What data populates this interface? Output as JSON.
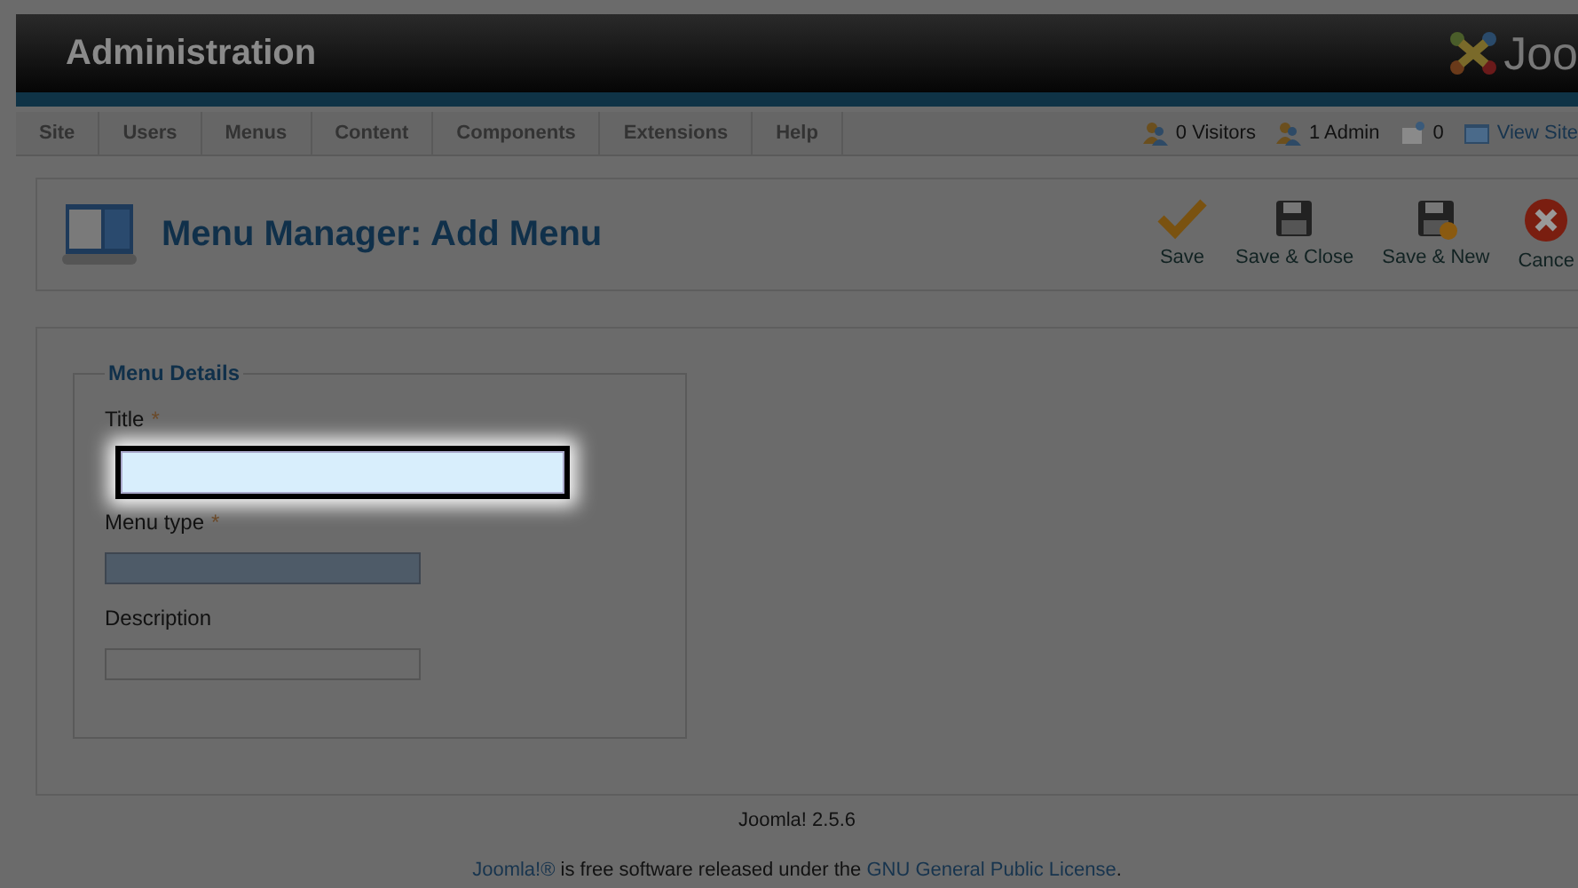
{
  "header": {
    "title": "Administration",
    "logo_text": "Joo"
  },
  "menu": [
    {
      "label": "Site"
    },
    {
      "label": "Users"
    },
    {
      "label": "Menus"
    },
    {
      "label": "Content"
    },
    {
      "label": "Components"
    },
    {
      "label": "Extensions"
    },
    {
      "label": "Help"
    }
  ],
  "status": [
    {
      "kind": "visitors",
      "label": "0 Visitors"
    },
    {
      "kind": "admin",
      "label": "1 Admin"
    },
    {
      "kind": "messages",
      "label": "0"
    },
    {
      "kind": "link",
      "label": "View Site"
    }
  ],
  "page_title": "Menu Manager: Add Menu",
  "toolbar": [
    {
      "kind": "save",
      "label": "Save"
    },
    {
      "kind": "save-close",
      "label": "Save & Close"
    },
    {
      "kind": "save-new",
      "label": "Save & New"
    },
    {
      "kind": "cancel",
      "label": "Cance"
    }
  ],
  "fieldset": {
    "legend": "Menu Details",
    "fields": [
      {
        "label": "Title",
        "required_mark": "*",
        "focused": true,
        "disabled": false
      },
      {
        "label": "Menu type",
        "required_mark": "*",
        "focused": false,
        "disabled": true
      },
      {
        "label": "Description",
        "focused": false,
        "disabled": false
      }
    ]
  },
  "footer": {
    "version": "Joomla! 2.5.6",
    "license": [
      {
        "kind": "link",
        "text": "Joomla!®"
      },
      {
        "kind": "text",
        "text": " is free software released under the "
      },
      {
        "kind": "link",
        "text": "GNU General Public License"
      },
      {
        "kind": "text",
        "text": "."
      }
    ]
  }
}
